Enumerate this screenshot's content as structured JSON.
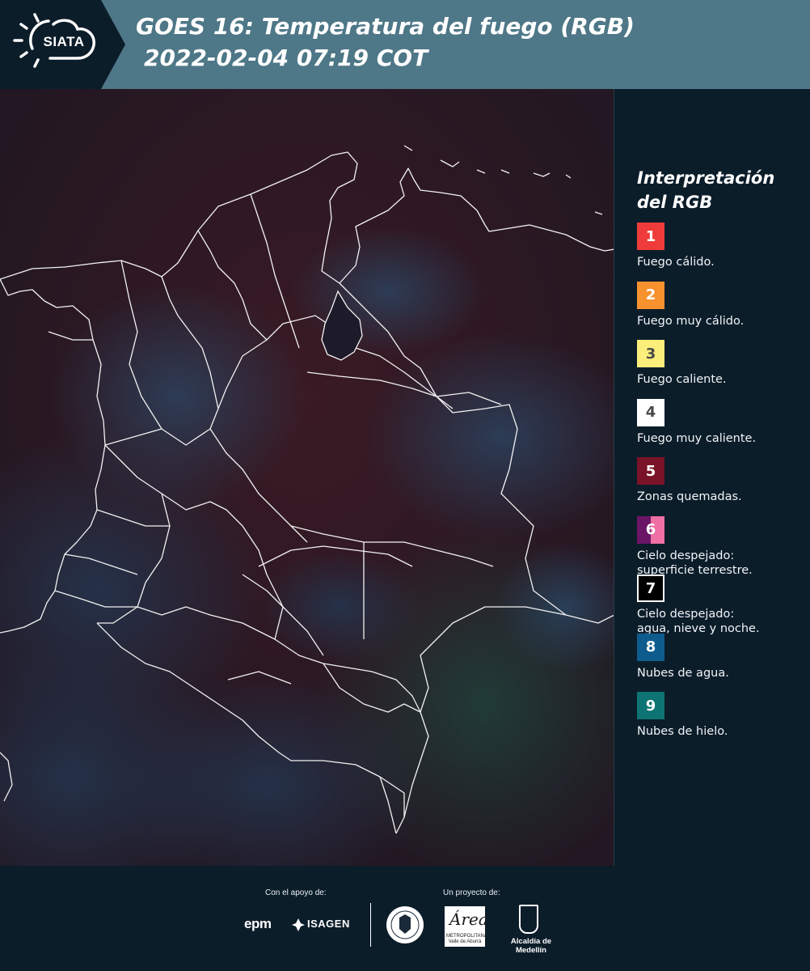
{
  "header": {
    "logo_text": "SIATA",
    "title_line1": "GOES 16: Temperatura del fuego (RGB)",
    "title_line2": "2022-02-04 07:19 COT",
    "bg_color": "#4e7787",
    "logo_bg_color": "#0c1d2a"
  },
  "legend": {
    "title_line1": "Interpretación",
    "title_line2": "del RGB",
    "items": [
      {
        "number": "1",
        "label": "Fuego cálido.",
        "color": "#ef3b39"
      },
      {
        "number": "2",
        "label": "Fuego muy cálido.",
        "color": "#f7922f"
      },
      {
        "number": "3",
        "label": "Fuego caliente.",
        "color": "#fbee7a"
      },
      {
        "number": "4",
        "label": "Fuego muy caliente.",
        "color": "#ffffff"
      },
      {
        "number": "5",
        "label": "Zonas quemadas.",
        "color": "#7a1327"
      },
      {
        "number": "6",
        "label_line1": "Cielo despejado:",
        "label_line2": "superficie terrestre.",
        "color_left": "#6b1567",
        "color_right": "#ef70a4"
      },
      {
        "number": "7",
        "label_line1": "Cielo despejado:",
        "label_line2": "agua, nieve y noche.",
        "color": "#000000"
      },
      {
        "number": "8",
        "label": "Nubes de agua.",
        "color": "#0e5c8e"
      },
      {
        "number": "9",
        "label": "Nubes de hielo.",
        "color": "#0e7373"
      }
    ]
  },
  "footer": {
    "support_label": "Con el apoyo de:",
    "project_label": "Un proyecto de:",
    "epm_text": "epm",
    "isagen_text": "ISAGEN",
    "area_big": "Área",
    "area_small": "METROPOLITANA Valle de Aburrá",
    "alcaldia_text": "Alcaldía de Medellín"
  }
}
